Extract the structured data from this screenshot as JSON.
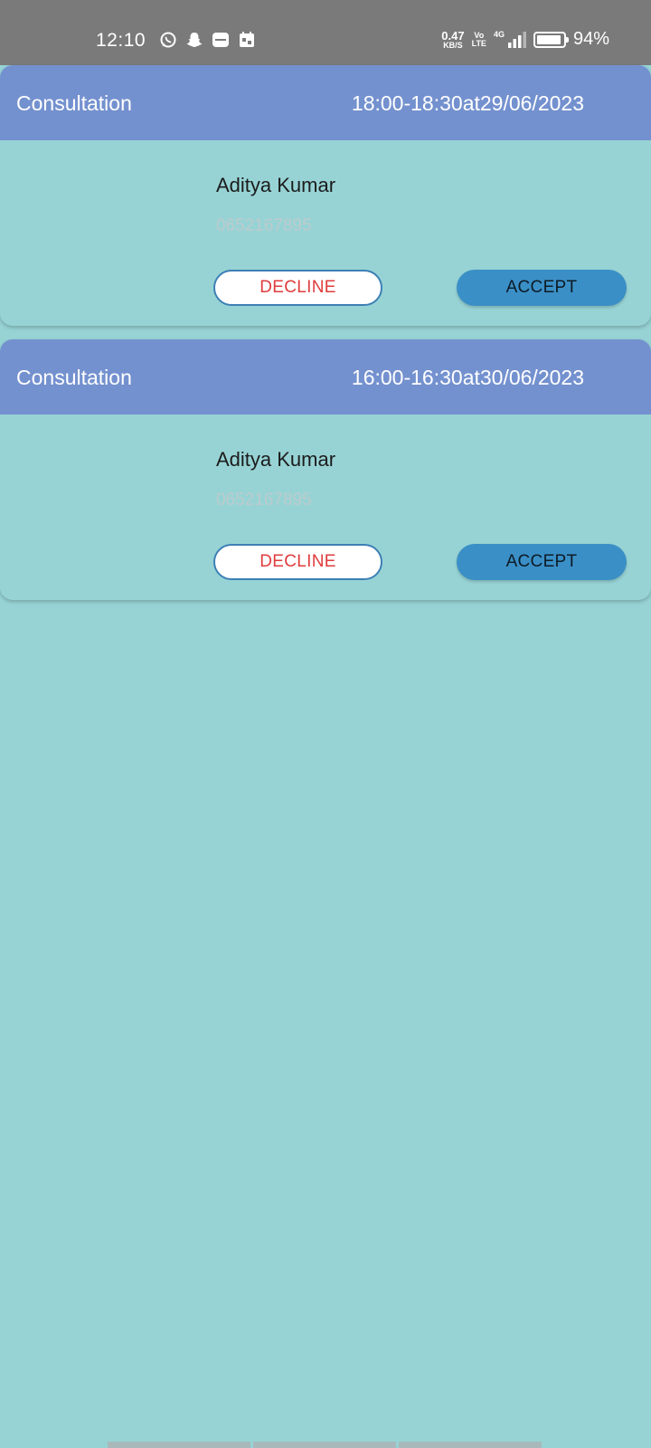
{
  "status_bar": {
    "time": "12:10",
    "notification_icons": [
      "whatsapp-icon",
      "snapchat-icon",
      "zomato-icon",
      "calendar-icon"
    ],
    "network_speed_value": "0.47",
    "network_speed_unit": "KB/S",
    "volte_top": "Vo",
    "volte_bottom": "LTE",
    "signal_label": "4G",
    "battery_percent": "94%",
    "battery_level": 0.94
  },
  "appointments": [
    {
      "title": "Consultation",
      "time": "18:00-18:30at29/06/2023",
      "patient_name": "Aditya Kumar",
      "phone": "0652167895",
      "decline_label": "DECLINE",
      "accept_label": "ACCEPT"
    },
    {
      "title": "Consultation",
      "time": "16:00-16:30at30/06/2023",
      "patient_name": "Aditya Kumar",
      "phone": "0652167895",
      "decline_label": "DECLINE",
      "accept_label": "ACCEPT"
    }
  ],
  "colors": {
    "background": "#97d3d5",
    "header": "#7491cf",
    "status_bar": "#7a7a7a",
    "accept": "#3a8fc6",
    "decline_text": "#e03c3c"
  }
}
